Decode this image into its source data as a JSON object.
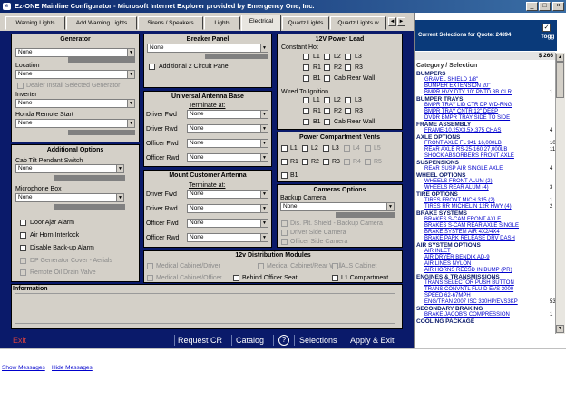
{
  "window": {
    "title": "Ez-ONE Mainline Configurator - Microsoft Internet Explorer provided by Emergency One, Inc.",
    "min": "_",
    "max": "□",
    "close": "×"
  },
  "tabs": [
    "Warning Lights",
    "Add Warning Lights",
    "Sirens / Speakers",
    "Lights",
    "Electrical",
    "Quartz Lights",
    "Quartz Lights w"
  ],
  "tab_arrows": {
    "left": "◄",
    "right": "►"
  },
  "generator": {
    "title": "Generator",
    "type_value": "None",
    "location_label": "Location",
    "location_value": "None",
    "dealer_install": "Dealer Install Selected Generator",
    "inverter_label": "Inverter",
    "inverter_value": "None",
    "honda_label": "Honda Remote Start",
    "honda_value": "None"
  },
  "additional": {
    "title": "Additional Options",
    "cab_tilt_label": "Cab Tilt Pendant Switch",
    "cab_tilt_value": "None",
    "mic_label": "Microphone Box",
    "mic_value": "None",
    "checks": [
      {
        "label": "Door Ajar Alarm",
        "disabled": false
      },
      {
        "label": "Air Horn Interlock",
        "disabled": false
      },
      {
        "label": "Disable Back-up Alarm",
        "disabled": false
      },
      {
        "label": "DP Generator Cover - Aerials",
        "disabled": true
      },
      {
        "label": "Remote Oil Drain Valve",
        "disabled": true
      }
    ]
  },
  "breaker": {
    "title": "Breaker Panel",
    "value": "None",
    "add_circuit": "Additional 2 Circuit Panel"
  },
  "antenna_base": {
    "title": "Universal Antenna Base",
    "terminate_label": "Terminate at:",
    "rows": [
      {
        "label": "Driver Fwd",
        "value": "None"
      },
      {
        "label": "Driver Rwd",
        "value": "None"
      },
      {
        "label": "Officer Fwd",
        "value": "None"
      },
      {
        "label": "Officer Rwd",
        "value": "None"
      }
    ]
  },
  "mount_antenna": {
    "title": "Mount Customer Antenna",
    "terminate_label": "Terminate at:",
    "rows": [
      {
        "label": "Driver Fwd",
        "value": "None"
      },
      {
        "label": "Driver Rwd",
        "value": "None"
      },
      {
        "label": "Officer Fwd",
        "value": "None"
      },
      {
        "label": "Officer Rwd",
        "value": "None"
      }
    ]
  },
  "power_lead": {
    "title": "12V Power Lead",
    "constant_hot": "Constant Hot",
    "wired_ignition": "Wired To Ignition",
    "row1": [
      "L1",
      "L2",
      "L3"
    ],
    "row2": [
      "R1",
      "R2",
      "R3"
    ],
    "row3": [
      "B1",
      "Cab Rear Wall"
    ]
  },
  "vents": {
    "title": "Power Compartment Vents",
    "row1": [
      "L1",
      "L2",
      "L3",
      "L4",
      "L5"
    ],
    "row2": [
      "R1",
      "R2",
      "R3",
      "R4",
      "R5"
    ],
    "row3": [
      "B1"
    ]
  },
  "cameras": {
    "title": "Cameras Options",
    "backup_label": "Backup Camera",
    "backup_value": "None",
    "checks": [
      "Dis. Plt. Shield - Backup Camera",
      "Driver Side Camera",
      "Officer Side Camera"
    ]
  },
  "distribution": {
    "title": "12v Distribution Modules",
    "items": [
      {
        "label": "Medical Cabinet/Driver",
        "disabled": true
      },
      {
        "label": "Medical Cabinet/Rear Wall",
        "disabled": true
      },
      {
        "label": "ALS Cabinet",
        "disabled": true
      },
      {
        "label": "Medical Cabinet/Officer",
        "disabled": true
      },
      {
        "label": "Behind Officer Seat",
        "disabled": false
      },
      {
        "label": "L1 Compartment",
        "disabled": false
      }
    ]
  },
  "information": {
    "title": "Information"
  },
  "bottom": {
    "exit": "Exit",
    "request": "Request CR",
    "catalog": "Catalog",
    "help": "?",
    "selections": "Selections",
    "apply_exit": "Apply & Exit"
  },
  "quote": {
    "title": "Current Selections for Quote: 24894",
    "toggle": "Togg",
    "amount": "$ 266",
    "header": "Category / Selection"
  },
  "categories": [
    {
      "name": "BUMPERS",
      "items": [
        "GRAVEL SHIELD 1/8\"",
        "BUMPER EXTENSION 20\"",
        "BMPR HVY DTY 10\" PNTD 3B CLR"
      ],
      "nums": [
        "",
        "",
        "1"
      ]
    },
    {
      "name": "BUMPER TRAYS",
      "items": [
        "BMPR TRAY LID CTR DP WD-RNG",
        "BMPR TRAY CNTR 12\" DEEP",
        "DVDR BMPR TRAY SIDE TO SIDE"
      ],
      "nums": [
        "",
        "",
        ""
      ]
    },
    {
      "name": "FRAME ASSEMBLY",
      "items": [
        "FRAME-10.25X3.5X.375 CHAS"
      ],
      "nums": [
        "4"
      ]
    },
    {
      "name": "AXLE OPTIONS",
      "items": [
        "FRONT AXLE FL 941 16,000LB",
        "REAR AXLE RS-25-160 27,000LB",
        "SHOCK ABSORBERS FRONT AXLE"
      ],
      "nums": [
        "10",
        "11",
        ""
      ]
    },
    {
      "name": "SUSPENSIONS",
      "items": [
        "REAR SUSP AIR SINGLE AXLE"
      ],
      "nums": [
        "4"
      ]
    },
    {
      "name": "WHEEL OPTIONS",
      "items": [
        "WHEELS FRONT ALUM (2)",
        "WHEELS REAR ALUM (4)"
      ],
      "nums": [
        "",
        "3"
      ]
    },
    {
      "name": "TIRE OPTIONS",
      "items": [
        "TIRES FRONT MICH 315 (2)",
        "TIRES RR MICHELIN 12R HWY (4)"
      ],
      "nums": [
        "1",
        "2"
      ]
    },
    {
      "name": "BRAKE SYSTEMS",
      "items": [
        "BRAKES S-CAM FRONT AXLE",
        "BRAKES S-CAM REAR AXLE SINGLE",
        "BRAKE SYSTEM AIR 4X2/4X4",
        "BRAKE PARK RELEASE DRV DASH"
      ],
      "nums": [
        "",
        "",
        "",
        ""
      ]
    },
    {
      "name": "AIR SYSTEM OPTIONS",
      "items": [
        "AIR INLET",
        "AIR DRYER BENDIX AD-9",
        "AIR LINES NYLON",
        "AIR HORNS RECSD IN BUMP (PR)"
      ],
      "nums": [
        "",
        "",
        "",
        ""
      ]
    },
    {
      "name": "ENGINES & TRANSMISSIONS",
      "items": [
        "TRANS SELECTOR PUSH BUTTON",
        "TRANS CONVNTL FLUID EVS 3000",
        "SPEED 62-67MPH",
        "ENG/TRAN 2007 ISC 330HP/EVS3KP"
      ],
      "nums": [
        "",
        "",
        "",
        "53"
      ]
    },
    {
      "name": "SECONDARY BRAKING",
      "items": [
        "BRAKE JACOB'S COMPRESSION"
      ],
      "nums": [
        "1"
      ]
    },
    {
      "name": "COOLING PACKAGE",
      "items": [],
      "nums": []
    }
  ],
  "footer": {
    "show_messages": "Show Messages",
    "hide_messages": "Hide Messages"
  }
}
